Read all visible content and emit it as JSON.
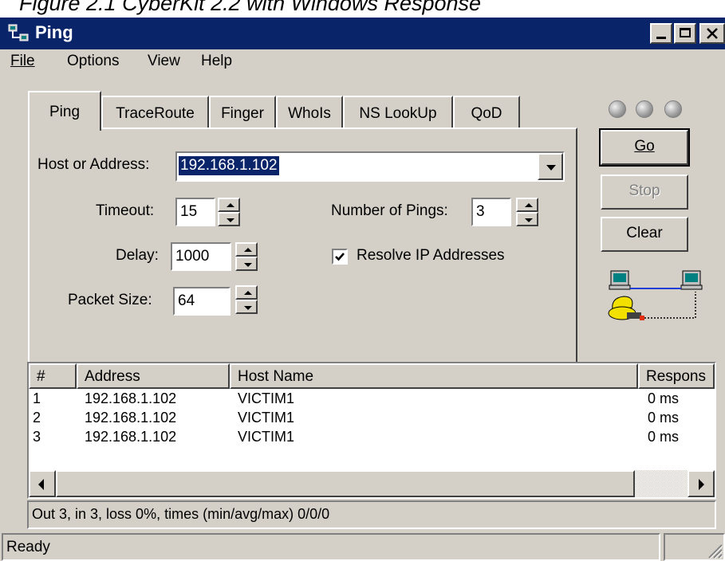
{
  "caption": "Figure 2.1 CyberKit 2.2 with Windows Response",
  "window": {
    "title": "Ping",
    "controls": {
      "minimize": "_",
      "maximize": "□",
      "close": "×"
    }
  },
  "menu": [
    {
      "label": "File"
    },
    {
      "label": "Options"
    },
    {
      "label": "View"
    },
    {
      "label": "Help"
    }
  ],
  "tabs": [
    {
      "label": "Ping",
      "active": true
    },
    {
      "label": "TraceRoute"
    },
    {
      "label": "Finger"
    },
    {
      "label": "WhoIs"
    },
    {
      "label": "NS LookUp"
    },
    {
      "label": "QoD"
    }
  ],
  "form": {
    "host_label": "Host or Address:",
    "host_value": "192.168.1.102",
    "timeout_label": "Timeout:",
    "timeout_value": "15",
    "delay_label": "Delay:",
    "delay_value": "1000",
    "packet_label": "Packet Size:",
    "packet_value": "64",
    "pings_label": "Number of Pings:",
    "pings_value": "3",
    "resolve_label": "Resolve IP Addresses",
    "resolve_checked": true
  },
  "buttons": {
    "go": "Go",
    "stop": "Stop",
    "clear": "Clear"
  },
  "results": {
    "columns": [
      "#",
      "Address",
      "Host Name",
      "Respons"
    ],
    "rows": [
      {
        "n": "1",
        "address": "192.168.1.102",
        "host": "VICTIM1",
        "response": "0 ms"
      },
      {
        "n": "2",
        "address": "192.168.1.102",
        "host": "VICTIM1",
        "response": "0 ms"
      },
      {
        "n": "3",
        "address": "192.168.1.102",
        "host": "VICTIM1",
        "response": "0 ms"
      }
    ]
  },
  "summary": "Out 3, in 3, loss 0%, times (min/avg/max) 0/0/0",
  "status": "Ready",
  "colors": {
    "titlebar": "#0a246a",
    "face": "#d4d0c8",
    "selection": "#0a246a",
    "cable": "#1f3fd6",
    "accent_red": "#e03010"
  }
}
